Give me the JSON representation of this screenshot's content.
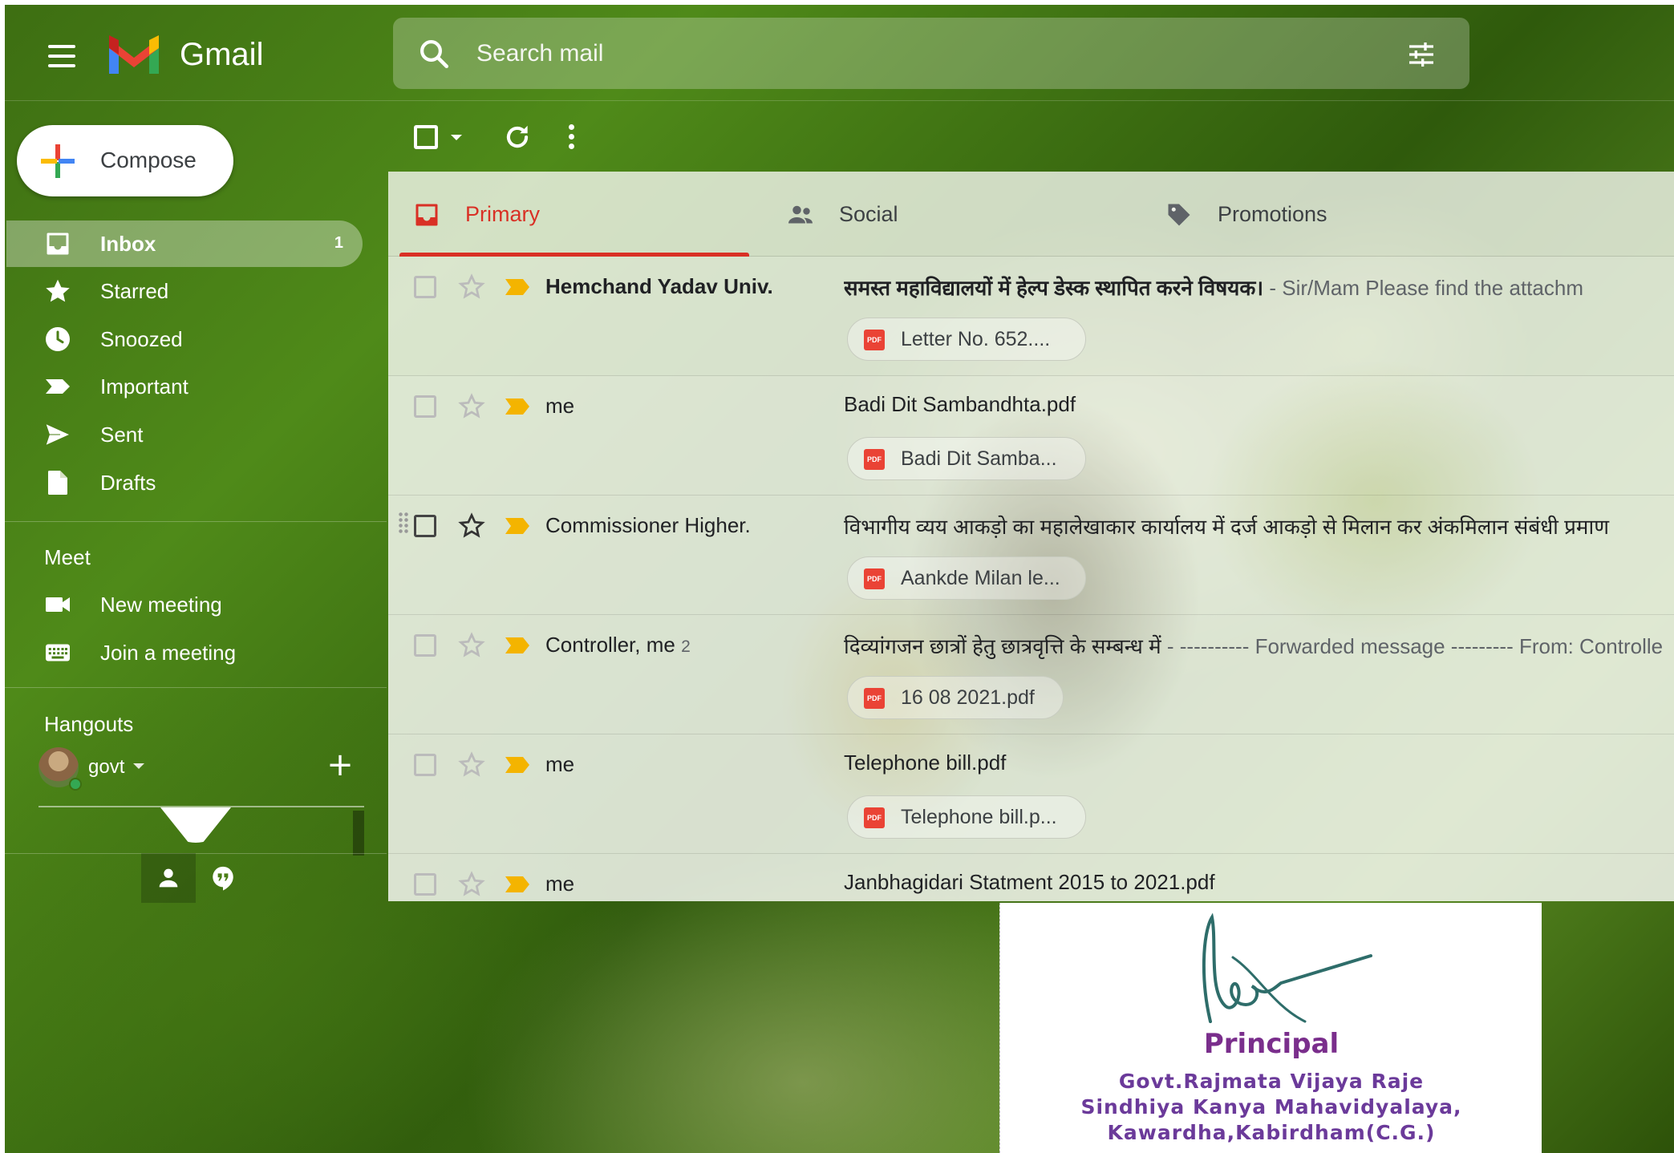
{
  "app": {
    "name": "Gmail"
  },
  "search": {
    "placeholder": "Search mail"
  },
  "compose": {
    "label": "Compose"
  },
  "nav": [
    {
      "label": "Inbox",
      "icon": "inbox-icon",
      "count": "1",
      "active": true
    },
    {
      "label": "Starred",
      "icon": "star-icon"
    },
    {
      "label": "Snoozed",
      "icon": "clock-icon"
    },
    {
      "label": "Important",
      "icon": "important-icon"
    },
    {
      "label": "Sent",
      "icon": "send-icon"
    },
    {
      "label": "Drafts",
      "icon": "draft-icon"
    }
  ],
  "meet": {
    "title": "Meet",
    "items": [
      {
        "label": "New meeting",
        "icon": "video-icon"
      },
      {
        "label": "Join a meeting",
        "icon": "keyboard-icon"
      }
    ]
  },
  "hangouts": {
    "title": "Hangouts",
    "user": "govt"
  },
  "tabs": [
    {
      "label": "Primary",
      "icon": "inbox-tab-icon",
      "active": true
    },
    {
      "label": "Social",
      "icon": "people-icon"
    },
    {
      "label": "Promotions",
      "icon": "tag-icon"
    }
  ],
  "emails": [
    {
      "sender": "Hemchand Yadav Univ.",
      "count": "",
      "subject": "समस्त महाविद्यालयों में हेल्प डेस्क स्थापित करने विषयक।",
      "snippet": " - Sir/Mam Please find the attachm",
      "attachment": "Letter No. 652....",
      "unread": true
    },
    {
      "sender": "me",
      "count": "",
      "subject": "Badi Dit Sambandhta.pdf",
      "snippet": "",
      "attachment": "Badi Dit Samba...",
      "unread": false
    },
    {
      "sender": "Commissioner Higher.",
      "count": "",
      "subject": "विभागीय व्यय आकड़ो का महालेखाकार कार्यालय में दर्ज आकड़ो से मिलान कर अंकमिलान संबंधी प्रमाण",
      "snippet": "",
      "attachment": "Aankde Milan le...",
      "unread": false
    },
    {
      "sender": "Controller, me",
      "count": "2",
      "subject": "दिव्यांगजन छात्रों हेतु छात्रवृत्ति के सम्बन्ध में",
      "snippet": " - ---------- Forwarded message --------- From: Controlle",
      "attachment": "16 08 2021.pdf",
      "unread": false
    },
    {
      "sender": "me",
      "count": "",
      "subject": "Telephone bill.pdf",
      "snippet": "",
      "attachment": "Telephone bill.p...",
      "unread": false
    },
    {
      "sender": "me",
      "count": "",
      "subject": "Janbhagidari Statment 2015 to 2021.pdf",
      "snippet": "",
      "attachment": "",
      "unread": false
    }
  ],
  "attachment_icon": {
    "label": "PDF"
  },
  "signature": {
    "title": "Principal",
    "lines": [
      "Govt.Rajmata Vijaya Raje",
      "Sindhiya Kanya Mahavidyalaya,",
      "Kawardha,Kabirdham(C.G.)"
    ]
  },
  "colors": {
    "accent": "#d93025",
    "important": "#f4b400",
    "pdf": "#ea4335",
    "online": "#34a853"
  }
}
